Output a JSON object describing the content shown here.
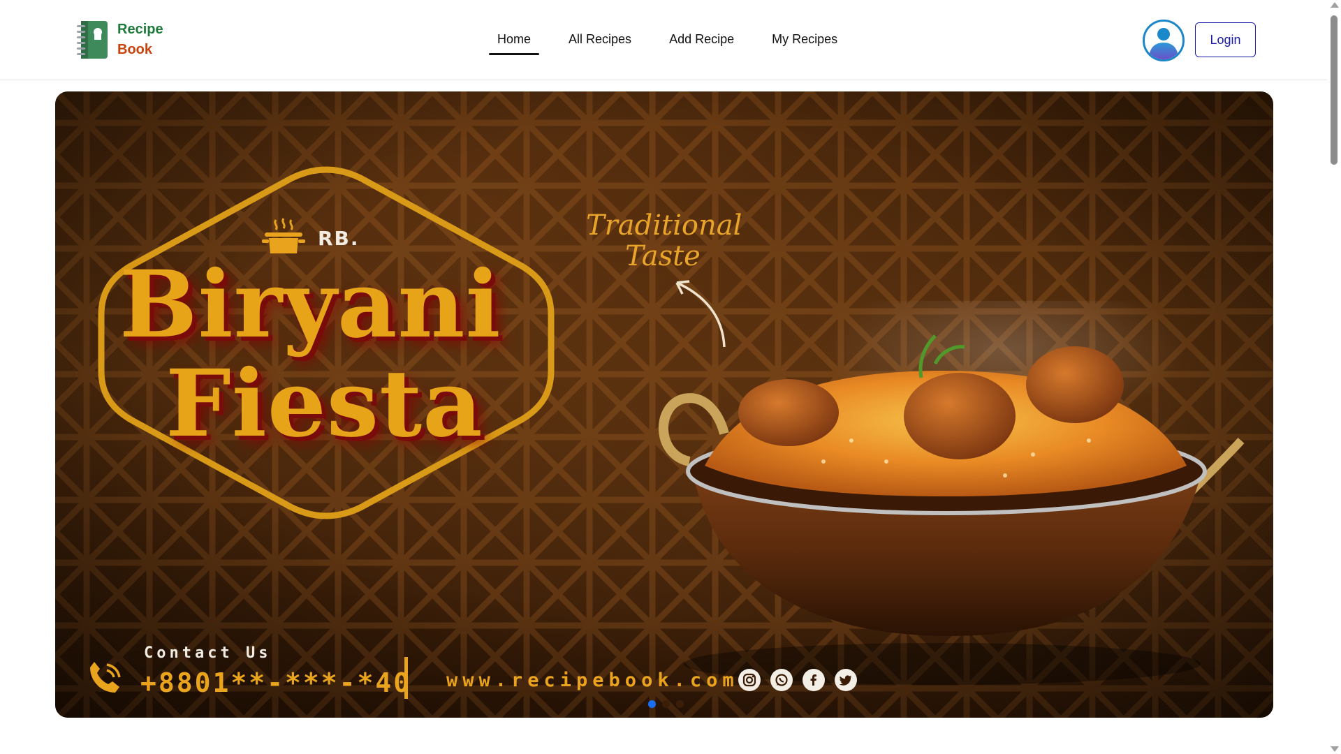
{
  "logo": {
    "line1": "Recipe",
    "line2": "Book",
    "icon": "recipe-book-icon"
  },
  "nav": {
    "items": [
      {
        "label": "Home",
        "active": true
      },
      {
        "label": "All Recipes",
        "active": false
      },
      {
        "label": "Add Recipe",
        "active": false
      },
      {
        "label": "My Recipes",
        "active": false
      }
    ]
  },
  "header": {
    "avatar_icon": "user-avatar-icon",
    "login_label": "Login"
  },
  "hero": {
    "brand": "RB.",
    "title_line1": "Biryani",
    "title_line2": "Fiesta",
    "tagline_line1": "Traditional",
    "tagline_line2": "Taste",
    "contact_label": "Contact Us",
    "phone": "+8801**-***-*40",
    "website": "www.recipebook.com",
    "socials": [
      "instagram-icon",
      "whatsapp-icon",
      "facebook-icon",
      "twitter-icon"
    ],
    "slides": 3,
    "active_slide": 1
  },
  "colors": {
    "accent_gold": "#e9a31c",
    "login_blue": "#1a1aa8",
    "logo_green": "#1e7a3a",
    "logo_orange": "#c8420e",
    "active_dot": "#1a6ff5"
  }
}
